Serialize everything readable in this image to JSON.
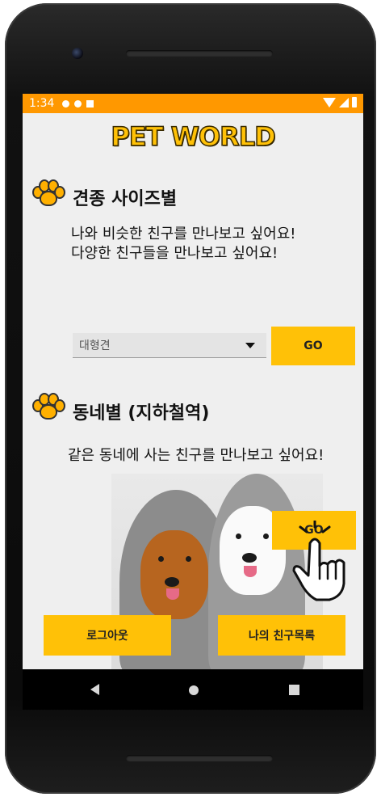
{
  "status_bar": {
    "time": "1:34"
  },
  "app": {
    "title": "PET WORLD"
  },
  "section_size": {
    "title": "견종 사이즈별",
    "desc_line1": "나와 비슷한 친구를 만나보고 싶어요!",
    "desc_line2": "다양한 친구들을 만나보고 싶어요!",
    "spinner_value": "대형견",
    "go_label": "GO"
  },
  "section_town": {
    "title": "동네별 (지하철역)",
    "desc": "같은 동네에 사는 친구를 만나보고 싶어요!",
    "go_label": "GO"
  },
  "buttons": {
    "logout": "로그아웃",
    "friend_list": "나의 친구목록"
  },
  "colors": {
    "status_bar": "#ff9800",
    "accent": "#ffc107",
    "screen_bg": "#efefef"
  },
  "icons": [
    "paw-icon",
    "dropdown-arrow-icon",
    "tap-hand-icon",
    "nav-back-icon",
    "nav-home-icon",
    "nav-recents-icon"
  ]
}
